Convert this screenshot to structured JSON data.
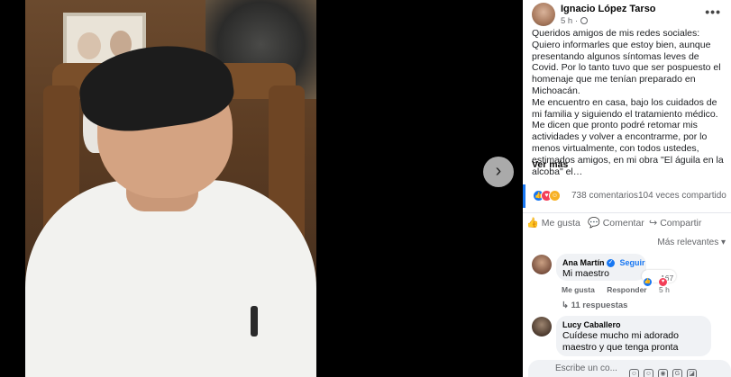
{
  "media": {
    "next_icon": "chevron-right-icon",
    "next_glyph": "›"
  },
  "post": {
    "author": "Ignacio López Tarso",
    "time": "5 h ·",
    "privacy_icon": "globe-icon",
    "more_glyph": "•••",
    "paragraphs": [
      "Queridos amigos de mis redes sociales:",
      "Quiero informarles que estoy bien, aunque presentando algunos síntomas leves de Covid. Por lo tanto tuvo que ser pospuesto el homenaje que me tenían preparado en Michoacán.",
      "Me encuentro en casa, bajo los cuidados de mi familia y siguiendo el tratamiento médico.",
      "Me dicen que pronto podré retomar mis actividades y volver a encontrarme, por lo menos virtualmente, con todos ustedes, estimados amigos, en mi obra \"El águila en la alcoba\" el…"
    ],
    "see_more": "Ver más"
  },
  "stats": {
    "reactions": [
      "like",
      "love",
      "care"
    ],
    "comments": "738 comentarios",
    "shares": "104 veces compartido"
  },
  "actions": {
    "like": "Me gusta",
    "comment": "Comentar",
    "share": "Compartir"
  },
  "comments": {
    "sort_label": "Más relevantes ▾",
    "items": [
      {
        "name": "Ana Martín",
        "follow": "Seguir",
        "text": "Mi maestro",
        "reaction_count": "167",
        "like": "Me gusta",
        "reply": "Responder",
        "time": "5 h",
        "replies": "11 respuestas"
      },
      {
        "name": "Lucy Caballero",
        "text_lines": [
          "Cuídese mucho mi adorado",
          "maestro y que tenga pronta"
        ]
      }
    ],
    "composer_placeholder": "Escribe un co..."
  },
  "colors": {
    "accent": "#1877f2",
    "muted": "#65676b",
    "bubble": "#f0f2f5"
  }
}
